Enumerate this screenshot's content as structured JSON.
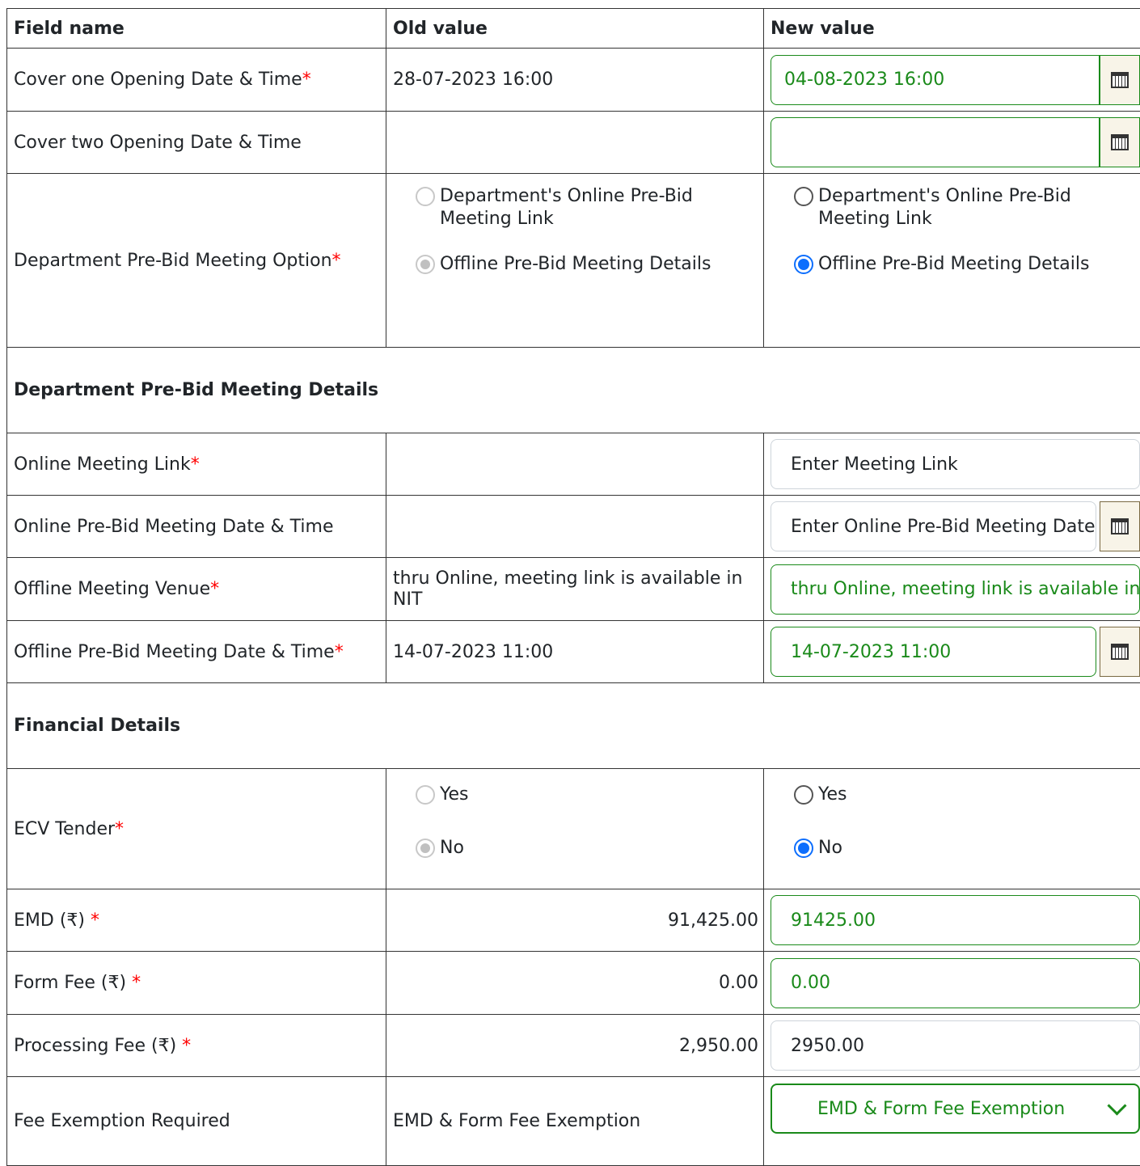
{
  "headers": {
    "field": "Field name",
    "old": "Old value",
    "new": "New value"
  },
  "rows": {
    "cover1": {
      "label": "Cover one Opening Date & Time",
      "old": "28-07-2023 16:00",
      "new": "04-08-2023 16:00"
    },
    "cover2": {
      "label": "Cover two Opening Date & Time",
      "old": "",
      "new": ""
    },
    "prebid_option": {
      "label": "Department Pre-Bid Meeting Option",
      "opt1": "Department's Online Pre-Bid Meeting Link",
      "opt2": "Offline Pre-Bid Meeting Details",
      "selected": "Offline Pre-Bid Meeting Details"
    },
    "online_link": {
      "label": "Online Meeting Link",
      "old": "",
      "placeholder": "Enter Meeting Link"
    },
    "online_dt": {
      "label": "Online Pre-Bid Meeting Date & Time",
      "old": "",
      "placeholder": "Enter Online Pre-Bid Meeting Date"
    },
    "offline_venue": {
      "label": "Offline Meeting Venue",
      "old": "thru Online, meeting link is available in NIT",
      "new": "thru Online, meeting link is available in NIT"
    },
    "offline_dt": {
      "label": "Offline Pre-Bid Meeting Date & Time",
      "old": "14-07-2023 11:00",
      "new": "14-07-2023 11:00"
    },
    "ecv": {
      "label": "ECV Tender",
      "opt_yes": "Yes",
      "opt_no": "No",
      "selected": "No"
    },
    "emd": {
      "label": "EMD (₹) ",
      "old": "91,425.00",
      "new": "91425.00"
    },
    "form_fee": {
      "label": "Form Fee (₹) ",
      "old": "0.00",
      "new": "0.00"
    },
    "processing_fee": {
      "label": "Processing Fee (₹) ",
      "old": "2,950.00",
      "new": "2950.00"
    },
    "fee_exemption": {
      "label": "Fee Exemption Required",
      "old": "EMD & Form Fee Exemption",
      "new": "EMD & Form Fee Exemption"
    }
  },
  "sections": {
    "prebid": "Department Pre-Bid Meeting Details",
    "financial": "Financial Details"
  },
  "required_mark": "*",
  "icons": {
    "calendar": "calendar-icon",
    "chevron": "chevron-down-icon"
  },
  "colors": {
    "changed": "#1a8a1a",
    "required": "#ff0000",
    "radio_selected": "#0d6efd"
  }
}
